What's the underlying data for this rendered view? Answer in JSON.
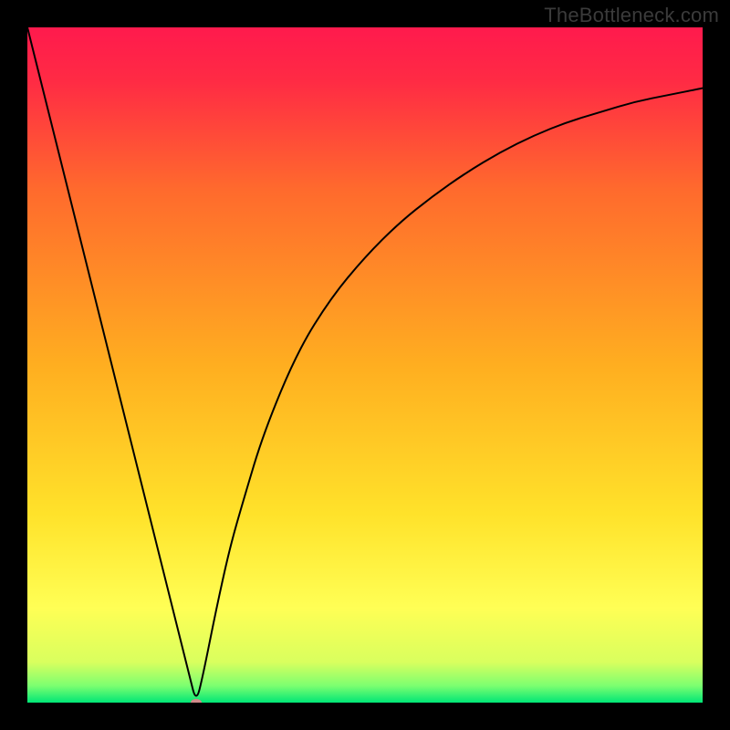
{
  "watermark": {
    "text": "TheBottleneck.com"
  },
  "chart_data": {
    "type": "line",
    "title": "",
    "xlabel": "",
    "ylabel": "",
    "xlim": [
      0,
      100
    ],
    "ylim": [
      0,
      100
    ],
    "grid": false,
    "legend": false,
    "background_gradient": {
      "direction": "vertical",
      "stops": [
        {
          "offset": 0.0,
          "color": "#ff1a4d"
        },
        {
          "offset": 0.08,
          "color": "#ff2b44"
        },
        {
          "offset": 0.24,
          "color": "#ff6a2d"
        },
        {
          "offset": 0.5,
          "color": "#ffae20"
        },
        {
          "offset": 0.72,
          "color": "#ffe22a"
        },
        {
          "offset": 0.86,
          "color": "#ffff55"
        },
        {
          "offset": 0.94,
          "color": "#d9ff5e"
        },
        {
          "offset": 0.975,
          "color": "#7cff70"
        },
        {
          "offset": 1.0,
          "color": "#00e676"
        }
      ]
    },
    "series": [
      {
        "name": "bottleneck-curve",
        "color": "#000000",
        "stroke_width": 2,
        "x": [
          0,
          5,
          10,
          15,
          20,
          24,
          25,
          26,
          28,
          30,
          32,
          35,
          40,
          45,
          50,
          55,
          60,
          65,
          70,
          75,
          80,
          85,
          90,
          95,
          100
        ],
        "y": [
          100,
          80,
          60,
          40,
          20,
          4,
          0,
          4,
          14,
          23,
          30,
          40,
          52,
          60,
          66,
          71,
          75,
          78.5,
          81.5,
          84,
          86,
          87.5,
          89,
          90,
          91
        ]
      }
    ],
    "marker": {
      "name": "minimum-point",
      "x": 25,
      "y": 0,
      "rx": 6,
      "ry": 4,
      "fill": "#d08a8a"
    }
  }
}
